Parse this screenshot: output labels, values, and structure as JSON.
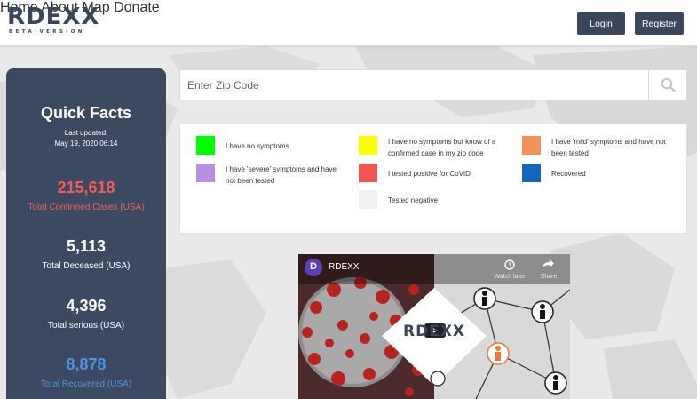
{
  "logo": {
    "name": "RDEXX",
    "tagline": "BETA VERSION"
  },
  "nav": {
    "home": "Home",
    "about": "About",
    "map": "Map",
    "donate": "Donate",
    "login": "Login",
    "register": "Register"
  },
  "facts": {
    "title": "Quick Facts",
    "updated_label": "Last updated:",
    "updated_date": "May 19, 2020 06:14",
    "stats": [
      {
        "value": "215,618",
        "label": "Total Confirmed Cases (USA)",
        "color": "#f25c5c"
      },
      {
        "value": "5,113",
        "label": "Total Deceased (USA)",
        "color": "#ffffff"
      },
      {
        "value": "4,396",
        "label": "Total serious (USA)",
        "color": "#ffffff"
      },
      {
        "value": "8,878",
        "label": "Total Recovered (USA)",
        "color": "#4f93e0"
      }
    ]
  },
  "search": {
    "placeholder": "Enter Zip Code",
    "icon": "search-icon"
  },
  "legend": {
    "items": [
      {
        "text": "I have no symptoms",
        "color": "#00ff00"
      },
      {
        "text": "I have no symptoms but know of a confirmed case in my zip code",
        "color": "#ffff00"
      },
      {
        "text": "I have 'mild' symptoms and have not been tested",
        "color": "#f39256"
      },
      {
        "text": "I have 'severe' symptoms and have not been tested",
        "color": "#b98fe0"
      },
      {
        "text": "I tested positive for CoVID",
        "color": "#f25555"
      },
      {
        "text": "Recovered",
        "color": "#1565c0"
      },
      {
        "text": "Tested negative",
        "color": "#f0f0f0"
      }
    ]
  },
  "video": {
    "channel_initial": "D",
    "channel_name": "RDEXX",
    "watch_later": "Watch later",
    "share": "Share",
    "logo_text": "RDEXX"
  },
  "colors": {
    "primary": "#3a475a",
    "panel": "#3b4a60"
  }
}
